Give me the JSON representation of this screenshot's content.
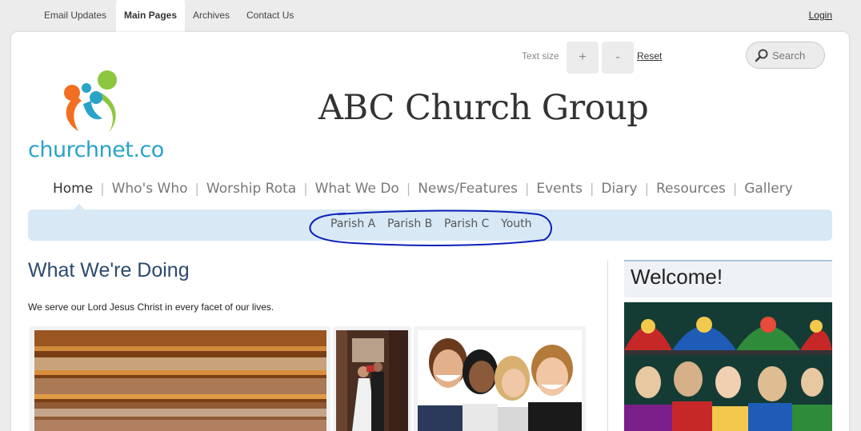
{
  "top_tabs": [
    {
      "label": "Email Updates",
      "active": false
    },
    {
      "label": "Main Pages",
      "active": true
    },
    {
      "label": "Archives",
      "active": false
    },
    {
      "label": "Contact Us",
      "active": false
    }
  ],
  "login_label": "Login",
  "text_size": {
    "label": "Text size",
    "increase": "+",
    "decrease": "-",
    "reset": "Reset"
  },
  "search": {
    "placeholder": "Search",
    "icon": "search-icon"
  },
  "logo": {
    "text": "churchnet.co",
    "colors": [
      "#f26f21",
      "#8cc63f",
      "#29a3c8"
    ]
  },
  "site_title": "ABC Church Group",
  "main_nav": [
    {
      "label": "Home",
      "active": true
    },
    {
      "label": "Who's Who"
    },
    {
      "label": "Worship Rota"
    },
    {
      "label": "What We Do"
    },
    {
      "label": "News/Features"
    },
    {
      "label": "Events"
    },
    {
      "label": "Diary"
    },
    {
      "label": "Resources"
    },
    {
      "label": "Gallery"
    }
  ],
  "sub_nav": [
    {
      "label": "Parish A"
    },
    {
      "label": "Parish B"
    },
    {
      "label": "Parish C"
    },
    {
      "label": "Youth"
    }
  ],
  "content": {
    "heading": "What We're Doing",
    "intro": "We serve our Lord Jesus Christ in every facet of our lives."
  },
  "sidebar": {
    "welcome_heading": "Welcome!"
  },
  "colors": {
    "accent_blue": "#2c4a6e",
    "subnav_bg": "#d8e9f5",
    "annotation": "#0a1fb8"
  }
}
